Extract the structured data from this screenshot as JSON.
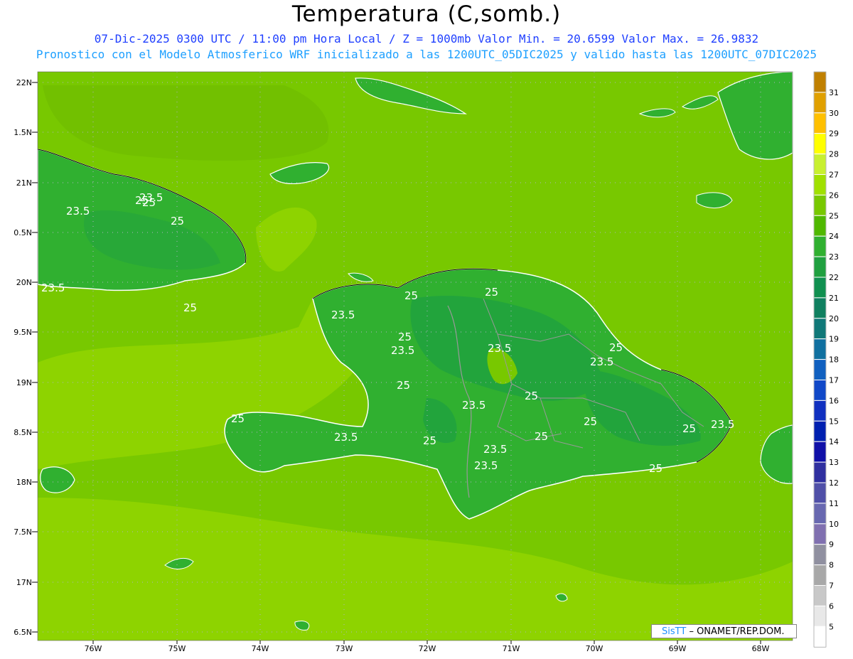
{
  "title": "Temperatura (C,somb.)",
  "subtitle1": "07-Dic-2025 0300 UTC / 11:00 pm Hora Local / Z = 1000mb  Valor Min. = 20.6599  Valor Max. = 26.9832",
  "subtitle2": "Pronostico con el Modelo Atmosferico WRF inicializado a las 1200UTC_05DIC2025 y valido hasta las  1200UTC_07DIC2025",
  "latitude_labels": [
    "22N",
    "1.5N",
    "21N",
    "0.5N",
    "20N",
    "9.5N",
    "19N",
    "8.5N",
    "18N",
    "7.5N",
    "17N",
    "6.5N"
  ],
  "longitude_labels": [
    "76W",
    "75W",
    "74W",
    "73W",
    "72W",
    "71W",
    "70W",
    "69W",
    "68W"
  ],
  "contour_labels": [
    "25",
    "23.5",
    "25",
    "23.5",
    "25",
    "25",
    "25",
    "23.5",
    "25",
    "23.5",
    "23.5",
    "25",
    "23.5",
    "25",
    "23.5",
    "25",
    "25",
    "25",
    "23.5",
    "23.5",
    "25",
    "23.5",
    "25",
    "23.5",
    "25",
    "25",
    "23.5",
    "25"
  ],
  "colorbar": {
    "labels": [
      "31",
      "30",
      "29",
      "28",
      "27",
      "26",
      "25",
      "24",
      "23",
      "22",
      "21",
      "20",
      "19",
      "18",
      "17",
      "16",
      "15",
      "14",
      "13",
      "12",
      "11",
      "10",
      "9",
      "8",
      "7",
      "6",
      "5"
    ],
    "colors": [
      "#c08000",
      "#e0a000",
      "#ffc000",
      "#ffff00",
      "#c8f030",
      "#a0e000",
      "#78c800",
      "#50b800",
      "#30b030",
      "#20a040",
      "#109050",
      "#108060",
      "#107878",
      "#1070a0",
      "#1060c0",
      "#1048c8",
      "#1030c0",
      "#0020b0",
      "#1010a8",
      "#3030a0",
      "#5050a8",
      "#6868b0",
      "#8070b0",
      "#9090a0",
      "#a8a8a8",
      "#c8c8c8",
      "#e8e8e8",
      "#ffffff"
    ]
  },
  "credit": {
    "sis": "SisTT",
    "rest": "– ONAMET/REP.DOM."
  },
  "colors": {
    "sea_warm": "#78c800",
    "sea_light": "#8ed300",
    "land": "#30b030",
    "land_dark": "#20a040"
  }
}
